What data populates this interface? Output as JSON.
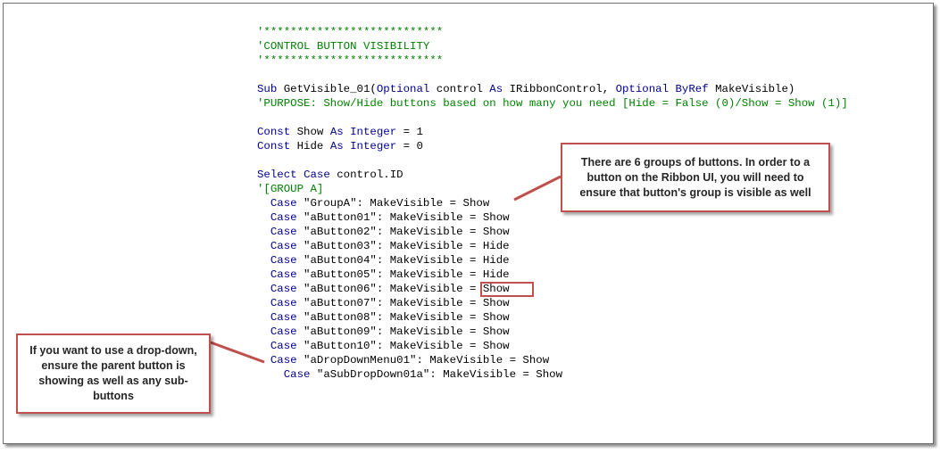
{
  "code_lines": [
    {
      "indent": "",
      "parts": [
        {
          "t": "'***************************",
          "c": "cm"
        }
      ]
    },
    {
      "indent": "",
      "parts": [
        {
          "t": "'CONTROL BUTTON VISIBILITY",
          "c": "cm"
        }
      ]
    },
    {
      "indent": "",
      "parts": [
        {
          "t": "'***************************",
          "c": "cm"
        }
      ]
    },
    {
      "indent": "",
      "parts": []
    },
    {
      "indent": "",
      "parts": [
        {
          "t": "Sub",
          "c": "kw"
        },
        {
          "t": " GetVisible_01(",
          "c": "str"
        },
        {
          "t": "Optional",
          "c": "kw"
        },
        {
          "t": " control ",
          "c": "str"
        },
        {
          "t": "As",
          "c": "kw"
        },
        {
          "t": " IRibbonControl, ",
          "c": "str"
        },
        {
          "t": "Optional",
          "c": "kw"
        },
        {
          "t": " ",
          "c": "str"
        },
        {
          "t": "ByRef",
          "c": "kw"
        },
        {
          "t": " MakeVisible)",
          "c": "str"
        }
      ]
    },
    {
      "indent": "",
      "parts": [
        {
          "t": "'PURPOSE: Show/Hide buttons based on how many you need [Hide = False (0)/Show = Show (1)]",
          "c": "cm"
        }
      ]
    },
    {
      "indent": "",
      "parts": []
    },
    {
      "indent": "",
      "parts": [
        {
          "t": "Const",
          "c": "kw"
        },
        {
          "t": " Show ",
          "c": "str"
        },
        {
          "t": "As",
          "c": "kw"
        },
        {
          "t": " ",
          "c": "str"
        },
        {
          "t": "Integer",
          "c": "kw"
        },
        {
          "t": " = 1",
          "c": "str"
        }
      ]
    },
    {
      "indent": "",
      "parts": [
        {
          "t": "Const",
          "c": "kw"
        },
        {
          "t": " Hide ",
          "c": "str"
        },
        {
          "t": "As",
          "c": "kw"
        },
        {
          "t": " ",
          "c": "str"
        },
        {
          "t": "Integer",
          "c": "kw"
        },
        {
          "t": " = 0",
          "c": "str"
        }
      ]
    },
    {
      "indent": "",
      "parts": []
    },
    {
      "indent": "",
      "parts": [
        {
          "t": "Select",
          "c": "kw"
        },
        {
          "t": " ",
          "c": "str"
        },
        {
          "t": "Case",
          "c": "kw"
        },
        {
          "t": " control.ID",
          "c": "str"
        }
      ]
    },
    {
      "indent": "",
      "parts": [
        {
          "t": "'[GROUP A]",
          "c": "cm"
        }
      ]
    },
    {
      "indent": "  ",
      "parts": [
        {
          "t": "Case",
          "c": "kw"
        },
        {
          "t": " \"GroupA\": MakeVisible = Show",
          "c": "str"
        }
      ]
    },
    {
      "indent": "  ",
      "parts": [
        {
          "t": "Case",
          "c": "kw"
        },
        {
          "t": " \"aButton01\": MakeVisible = Show",
          "c": "str"
        }
      ]
    },
    {
      "indent": "  ",
      "parts": [
        {
          "t": "Case",
          "c": "kw"
        },
        {
          "t": " \"aButton02\": MakeVisible = Show",
          "c": "str"
        }
      ]
    },
    {
      "indent": "  ",
      "parts": [
        {
          "t": "Case",
          "c": "kw"
        },
        {
          "t": " \"aButton03\": MakeVisible = Hide",
          "c": "str"
        }
      ]
    },
    {
      "indent": "  ",
      "parts": [
        {
          "t": "Case",
          "c": "kw"
        },
        {
          "t": " \"aButton04\": MakeVisible = Hide",
          "c": "str"
        }
      ]
    },
    {
      "indent": "  ",
      "parts": [
        {
          "t": "Case",
          "c": "kw"
        },
        {
          "t": " \"aButton05\": MakeVisible = Hide",
          "c": "str"
        }
      ]
    },
    {
      "indent": "  ",
      "parts": [
        {
          "t": "Case",
          "c": "kw"
        },
        {
          "t": " \"aButton06\": MakeVisible = Show",
          "c": "str"
        }
      ]
    },
    {
      "indent": "  ",
      "parts": [
        {
          "t": "Case",
          "c": "kw"
        },
        {
          "t": " \"aButton07\": MakeVisible = Show",
          "c": "str"
        }
      ]
    },
    {
      "indent": "  ",
      "parts": [
        {
          "t": "Case",
          "c": "kw"
        },
        {
          "t": " \"aButton08\": MakeVisible = Show",
          "c": "str"
        }
      ]
    },
    {
      "indent": "  ",
      "parts": [
        {
          "t": "Case",
          "c": "kw"
        },
        {
          "t": " \"aButton09\": MakeVisible = Show",
          "c": "str"
        }
      ]
    },
    {
      "indent": "  ",
      "parts": [
        {
          "t": "Case",
          "c": "kw"
        },
        {
          "t": " \"aButton10\": MakeVisible = Show",
          "c": "str"
        }
      ]
    },
    {
      "indent": "  ",
      "parts": [
        {
          "t": "Case",
          "c": "kw"
        },
        {
          "t": " \"aDropDownMenu01\": MakeVisible = Show",
          "c": "str"
        }
      ]
    },
    {
      "indent": "    ",
      "parts": [
        {
          "t": "Case",
          "c": "kw"
        },
        {
          "t": " \"aSubDropDown01a\": MakeVisible = Show",
          "c": "str"
        }
      ]
    }
  ],
  "callouts": {
    "groups": "There are 6 groups of buttons. In order to a button on the Ribbon UI, you will need to ensure that button's group  is visible as well",
    "dropdown": "If you want to use a drop-down, ensure the parent button is showing as well as any sub-buttons"
  },
  "colors": {
    "comment": "#008000",
    "keyword": "#00008b",
    "callout_border": "#c0504d"
  }
}
